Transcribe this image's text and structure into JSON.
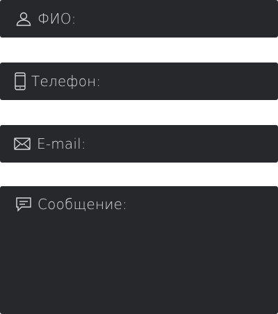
{
  "form": {
    "fields": [
      {
        "name": "name",
        "placeholder": "ФИО:",
        "icon": "user-icon"
      },
      {
        "name": "phone",
        "placeholder": "Телефон:",
        "icon": "smartphone-icon"
      },
      {
        "name": "email",
        "placeholder": "E-mail:",
        "icon": "envelope-icon"
      },
      {
        "name": "message",
        "placeholder": "Сообщение:",
        "icon": "message-icon"
      }
    ]
  },
  "colors": {
    "field_background": "#27282b",
    "placeholder_text": "#d9d9dc",
    "page_background": "#ffffff"
  }
}
